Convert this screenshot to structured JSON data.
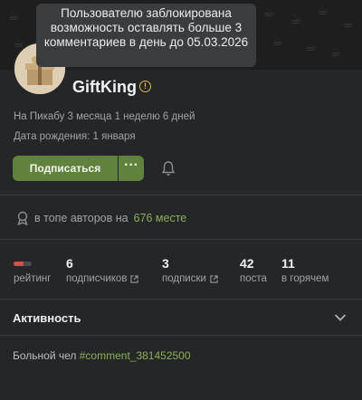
{
  "tooltip": {
    "text": "Пользователю заблокирована возможность оставлять больше 3 комментариев в день до 05.03.2026"
  },
  "profile": {
    "username": "GiftKing",
    "warning_icon": "exclamation-circle-icon",
    "on_site": "На Пикабу 3 месяца 1 неделю 6 дней",
    "birthday": "Дата рождения: 1 января"
  },
  "actions": {
    "subscribe_label": "Подписаться",
    "more_label": "···",
    "bell_icon": "bell-icon"
  },
  "top_authors": {
    "prefix": "в топе авторов на",
    "place": "676 месте",
    "icon": "award-icon"
  },
  "stats": {
    "rating": {
      "label": "рейтинг",
      "fill": 0.55,
      "color": "#d64b4b"
    },
    "subscribers": {
      "value": "6",
      "label": "подписчиков"
    },
    "subscriptions": {
      "value": "3",
      "label": "подписки"
    },
    "posts": {
      "value": "42",
      "label": "поста"
    },
    "hot": {
      "value": "11",
      "label": "в горячем"
    }
  },
  "activity": {
    "title": "Активность",
    "comment_text": "Больной чел",
    "comment_tag": "#comment_381452500"
  },
  "colors": {
    "accent_green": "#61823d",
    "link_green": "#8cae5a",
    "background": "#252628"
  }
}
